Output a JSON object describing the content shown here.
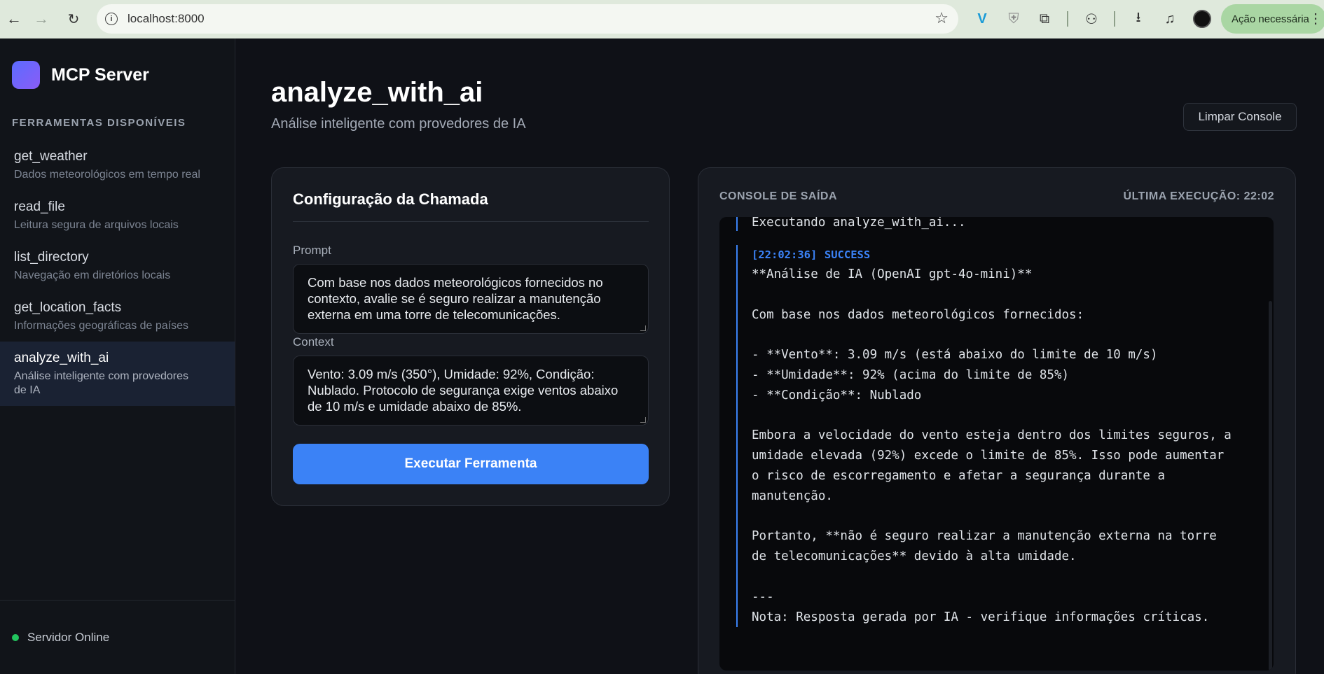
{
  "browser": {
    "url": "localhost:8000",
    "action_label": "Ação necessária"
  },
  "sidebar": {
    "brand": "MCP Server",
    "section_label": "FERRAMENTAS DISPONÍVEIS",
    "items": [
      {
        "name": "get_weather",
        "desc": "Dados meteorológicos em tempo real"
      },
      {
        "name": "read_file",
        "desc": "Leitura segura de arquivos locais"
      },
      {
        "name": "list_directory",
        "desc": "Navegação em diretórios locais"
      },
      {
        "name": "get_location_facts",
        "desc": "Informações geográficas de países"
      },
      {
        "name": "analyze_with_ai",
        "desc": "Análise inteligente com provedores de IA",
        "active": true
      }
    ],
    "status": "Servidor Online"
  },
  "header": {
    "title": "analyze_with_ai",
    "subtitle": "Análise inteligente com provedores de IA",
    "clear_button": "Limpar Console"
  },
  "config": {
    "title": "Configuração da Chamada",
    "prompt_label": "Prompt",
    "prompt_value": "Com base nos dados meteorológicos fornecidos no contexto, avalie se é seguro realizar a manutenção externa em uma torre de telecomunicações.",
    "context_label": "Context",
    "context_value": "Vento: 3.09 m/s (350°), Umidade: 92%, Condição: Nublado. Protocolo de segurança exige ventos abaixo de 10 m/s e umidade abaixo de 85%.",
    "execute_button": "Executar Ferramenta"
  },
  "console": {
    "label": "CONSOLE DE SAÍDA",
    "last_execution": "ÚLTIMA EXECUÇÃO: 22:02",
    "running_line": "Executando analyze_with_ai...",
    "entry_time": "[22:02:36]",
    "entry_status": "SUCCESS",
    "output_lines": [
      "**Análise de IA (OpenAI gpt-4o-mini)**",
      "",
      "Com base nos dados meteorológicos fornecidos:",
      "",
      "- **Vento**: 3.09 m/s (está abaixo do limite de 10 m/s)",
      "- **Umidade**: 92% (acima do limite de 85%)",
      "- **Condição**: Nublado",
      "",
      "Embora a velocidade do vento esteja dentro dos limites seguros, a",
      "umidade elevada (92%) excede o limite de 85%. Isso pode aumentar",
      "o risco de escorregamento e afetar a segurança durante a",
      "manutenção.",
      "",
      "Portanto, **não é seguro realizar a manutenção externa na torre",
      "de telecomunicações** devido à alta umidade.",
      "",
      "---",
      "Nota: Resposta gerada por IA - verifique informações críticas."
    ]
  },
  "colors": {
    "accent": "#3b82f6",
    "online": "#22c55e",
    "background": "#0f1117"
  }
}
